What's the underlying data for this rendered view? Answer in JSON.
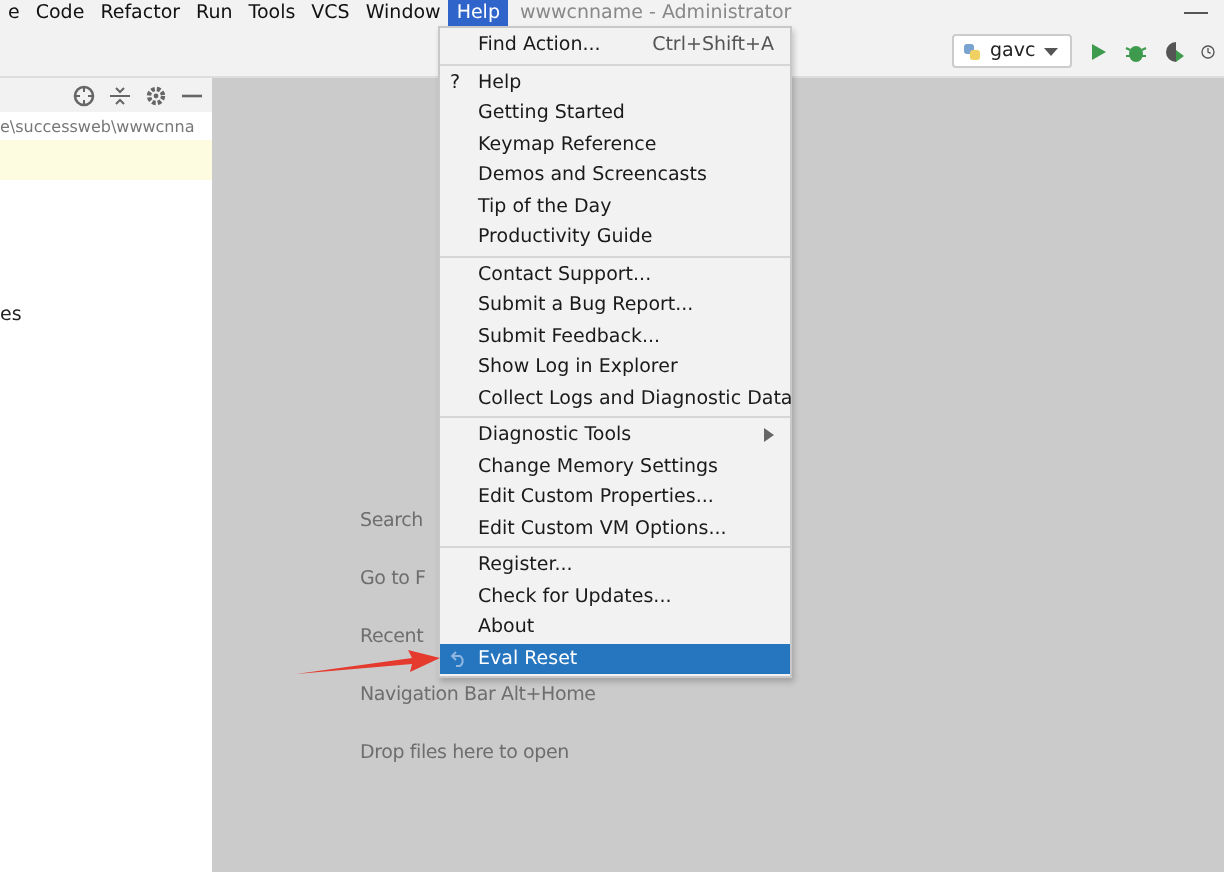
{
  "menu_bar": {
    "items": [
      {
        "label": "e",
        "selected": false
      },
      {
        "label": "Code",
        "selected": false
      },
      {
        "label": "Refactor",
        "selected": false
      },
      {
        "label": "Run",
        "selected": false
      },
      {
        "label": "Tools",
        "selected": false
      },
      {
        "label": "VCS",
        "selected": false
      },
      {
        "label": "Window",
        "selected": false
      },
      {
        "label": "Help",
        "selected": true
      }
    ],
    "title": "wwwcnname - Administrator"
  },
  "toolbar": {
    "run_config": "gavc"
  },
  "project_panel": {
    "path": "e\\successweb\\wwwcnna",
    "items": [
      "es"
    ]
  },
  "editor_hints": [
    "Search",
    "Go to F",
    "Recent",
    "Navigation Bar Alt+Home",
    "Drop files here to open"
  ],
  "help_menu": {
    "groups": [
      [
        {
          "label": "Find Action...",
          "shortcut": "Ctrl+Shift+A",
          "selected": false
        }
      ],
      [
        {
          "label": "Help",
          "prefix": "?",
          "selected": false
        },
        {
          "label": "Getting Started",
          "selected": false
        },
        {
          "label": "Keymap Reference",
          "selected": false
        },
        {
          "label": "Demos and Screencasts",
          "selected": false
        },
        {
          "label": "Tip of the Day",
          "selected": false
        },
        {
          "label": "Productivity Guide",
          "selected": false
        }
      ],
      [
        {
          "label": "Contact Support...",
          "selected": false
        },
        {
          "label": "Submit a Bug Report...",
          "selected": false
        },
        {
          "label": "Submit Feedback...",
          "selected": false
        },
        {
          "label": "Show Log in Explorer",
          "selected": false
        },
        {
          "label": "Collect Logs and Diagnostic Data",
          "selected": false
        }
      ],
      [
        {
          "label": "Diagnostic Tools",
          "submenu": true,
          "selected": false
        },
        {
          "label": "Change Memory Settings",
          "selected": false
        },
        {
          "label": "Edit Custom Properties...",
          "selected": false
        },
        {
          "label": "Edit Custom VM Options...",
          "selected": false
        }
      ],
      [
        {
          "label": "Register...",
          "selected": false
        },
        {
          "label": "Check for Updates...",
          "selected": false
        },
        {
          "label": "About",
          "selected": false
        },
        {
          "label": "Eval Reset",
          "icon": true,
          "selected": true
        }
      ]
    ]
  }
}
